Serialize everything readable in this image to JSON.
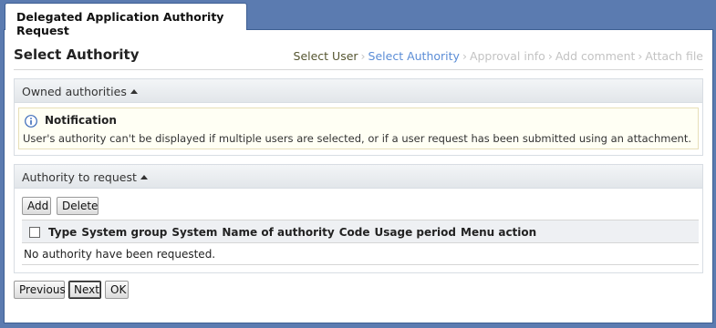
{
  "tab": {
    "title": "Delegated Application Authority Request"
  },
  "page": {
    "title": "Select Authority"
  },
  "steps": [
    {
      "label": "Select User",
      "state": "done"
    },
    {
      "label": "Select Authority",
      "state": "active"
    },
    {
      "label": "Approval info",
      "state": "inactive"
    },
    {
      "label": "Add comment",
      "state": "inactive"
    },
    {
      "label": "Attach file",
      "state": "inactive"
    }
  ],
  "owned": {
    "header": "Owned authorities",
    "notification": {
      "icon": "info-icon",
      "title": "Notification",
      "text": "User's authority can't be displayed if multiple users are selected, or if a user request has been submitted using an attachment."
    }
  },
  "request": {
    "header": "Authority to request",
    "add_label": "Add",
    "delete_label": "Delete",
    "columns": [
      "Type",
      "System group",
      "System",
      "Name of authority",
      "Code",
      "Usage period",
      "Menu action"
    ],
    "empty_text": "No authority have been requested."
  },
  "footer": {
    "previous_label": "Previous",
    "next_label": "Next",
    "ok_label": "OK"
  },
  "colors": {
    "background": "#5b7bb0",
    "step_active": "#5b8dd6",
    "step_done": "#555530",
    "step_inactive": "#c3c3c3",
    "notice_bg": "#fffff4"
  }
}
